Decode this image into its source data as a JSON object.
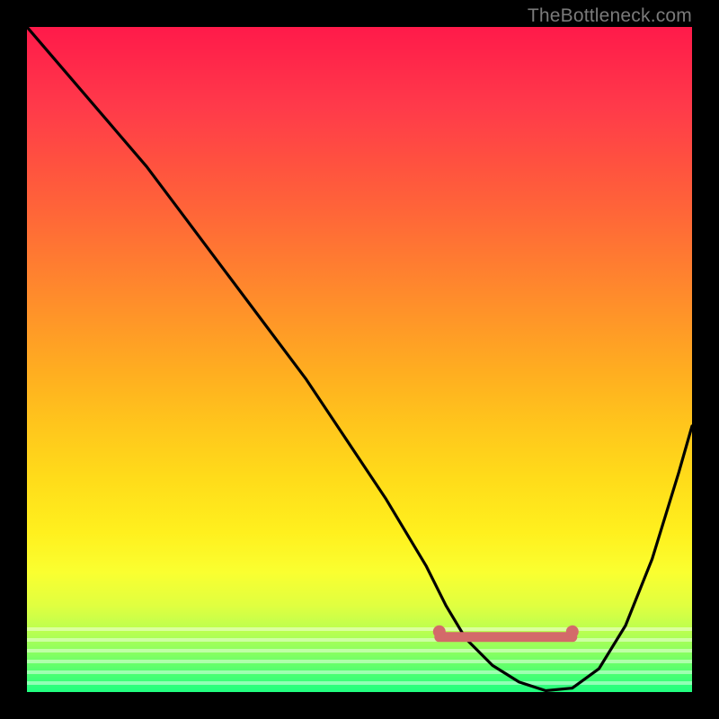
{
  "watermark": "TheBottleneck.com",
  "chart_data": {
    "type": "line",
    "title": "",
    "xlabel": "",
    "ylabel": "",
    "xlim": [
      0,
      100
    ],
    "ylim": [
      0,
      100
    ],
    "grid": false,
    "series": [
      {
        "name": "curve",
        "color": "#000000",
        "x": [
          0,
          6,
          12,
          18,
          24,
          30,
          36,
          42,
          48,
          54,
          60,
          63,
          66,
          70,
          74,
          78,
          82,
          86,
          90,
          94,
          98,
          100
        ],
        "y": [
          100,
          93,
          86,
          79,
          71,
          63,
          55,
          47,
          38,
          29,
          19,
          13,
          8,
          4,
          1.5,
          0.2,
          0.6,
          3.5,
          10,
          20,
          33,
          40
        ]
      },
      {
        "name": "flat-marker",
        "color": "#d36a6a",
        "x": [
          62,
          82
        ],
        "y": [
          8,
          8
        ]
      }
    ],
    "annotations": [],
    "background_gradient": {
      "top_color": "#ff1a4a",
      "bottom_color": "#20ff80"
    }
  }
}
